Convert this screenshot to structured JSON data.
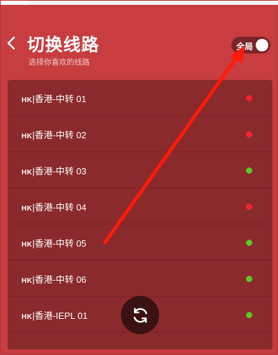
{
  "header": {
    "title": "切换线路",
    "subtitle": "选择你喜欢的线路",
    "back_icon": "chevron-left-icon",
    "toggle": {
      "label": "全局",
      "on": true
    }
  },
  "routes": [
    {
      "region": "HK",
      "label": "|香港-中转 01",
      "status": "red"
    },
    {
      "region": "HK",
      "label": "|香港-中转 02",
      "status": "red"
    },
    {
      "region": "HK",
      "label": "|香港-中转 03",
      "status": "green"
    },
    {
      "region": "HK",
      "label": "|香港-中转 04",
      "status": "red"
    },
    {
      "region": "HK",
      "label": "|香港-中转 05",
      "status": "green"
    },
    {
      "region": "HK",
      "label": "|香港-中转 06",
      "status": "green"
    },
    {
      "region": "HK",
      "label": "|香港-IEPL 01",
      "status": "green"
    }
  ],
  "refresh_icon": "refresh-icon",
  "colors": {
    "background": "#c73d40",
    "list_background": "#8a2a2c",
    "status_red": "#f0262b",
    "status_green": "#5cc82a",
    "annotation_arrow": "#ff1a0a"
  }
}
